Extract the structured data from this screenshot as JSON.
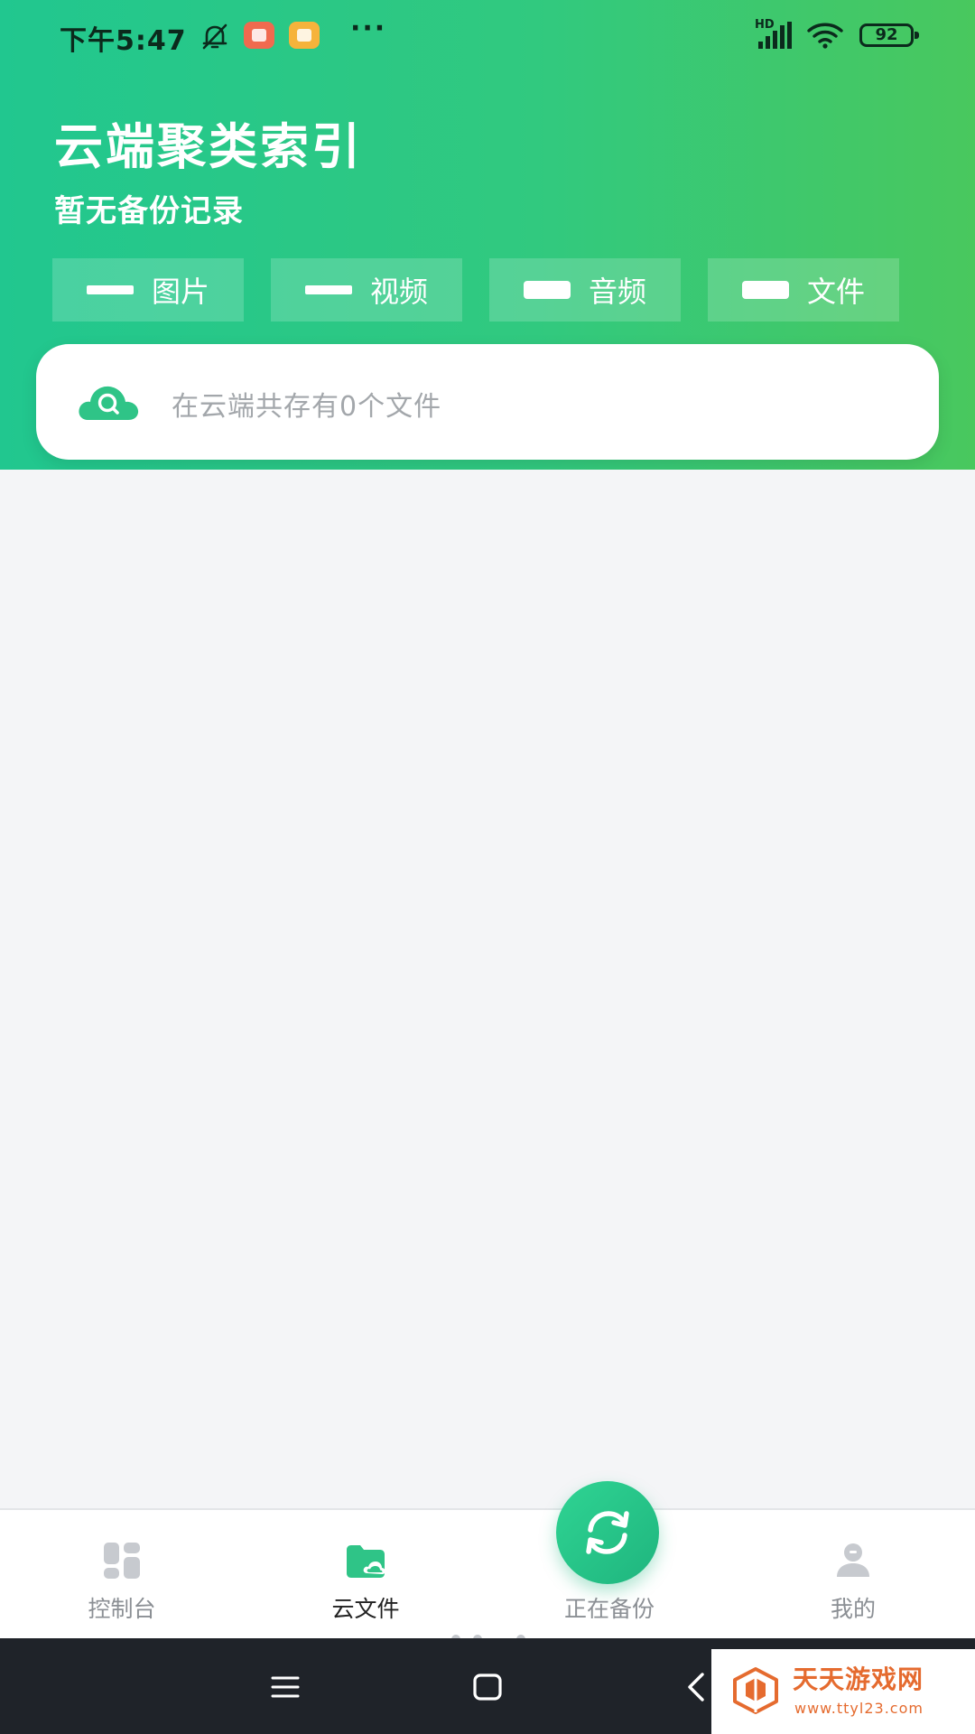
{
  "status_bar": {
    "time": "下午5:47",
    "more": "···",
    "network": "HD",
    "battery": "92"
  },
  "header": {
    "title": "云端聚类索引",
    "subtitle": "暂无备份记录"
  },
  "categories": [
    {
      "label": "图片",
      "icon": "thin-bar"
    },
    {
      "label": "视频",
      "icon": "thin-bar"
    },
    {
      "label": "音频",
      "icon": "thick-bar"
    },
    {
      "label": "文件",
      "icon": "thick-bar"
    }
  ],
  "search": {
    "placeholder": "在云端共存有0个文件",
    "icon": "cloud-search-icon"
  },
  "bottom_nav": {
    "items": [
      {
        "label": "控制台",
        "icon": "dashboard-icon",
        "active": false
      },
      {
        "label": "云文件",
        "icon": "cloud-folder-icon",
        "active": true
      },
      {
        "label": "正在备份",
        "icon": "sync-icon",
        "active": false
      },
      {
        "label": "我的",
        "icon": "user-icon",
        "active": false
      }
    ]
  },
  "watermark": {
    "name": "天天游戏网",
    "url": "www.ttyl23.com"
  },
  "colors": {
    "header_gradient_start": "#21c78f",
    "header_gradient_end": "#49c85e",
    "accent": "#2fc487",
    "placeholder_text": "#a3a7ab",
    "watermark": "#e56b2f"
  }
}
